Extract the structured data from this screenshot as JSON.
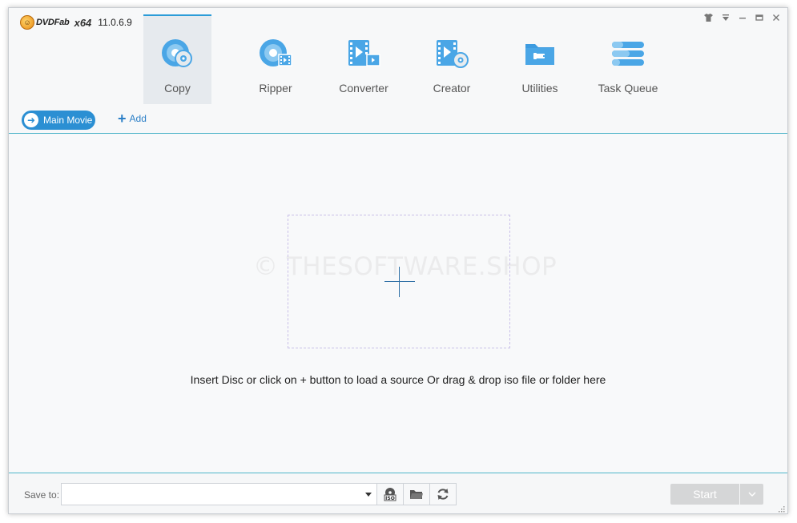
{
  "app": {
    "logo_text": "DVDFab",
    "arch": "x64",
    "version": "11.0.6.9"
  },
  "modules": [
    {
      "label": "Copy",
      "icon": "disc-copy-icon",
      "active": true
    },
    {
      "label": "Ripper",
      "icon": "disc-ripper-icon",
      "active": false
    },
    {
      "label": "Converter",
      "icon": "film-converter-icon",
      "active": false
    },
    {
      "label": "Creator",
      "icon": "film-creator-icon",
      "active": false
    },
    {
      "label": "Utilities",
      "icon": "toolbox-folder-icon",
      "active": false
    },
    {
      "label": "Task Queue",
      "icon": "task-queue-icon",
      "active": false
    }
  ],
  "subbar": {
    "mode_label": "Main Movie",
    "add_label": "Add"
  },
  "content": {
    "watermark": "© THESOFTWARE.SHOP",
    "hint": "Insert Disc or click on + button to load a source Or drag & drop iso file or folder here"
  },
  "bottom": {
    "save_to_label": "Save to:",
    "save_path": "",
    "start_label": "Start"
  },
  "colors": {
    "accent": "#2b8fd3",
    "divider": "#4fb5c9",
    "start_disabled": "#d5d6d7"
  }
}
